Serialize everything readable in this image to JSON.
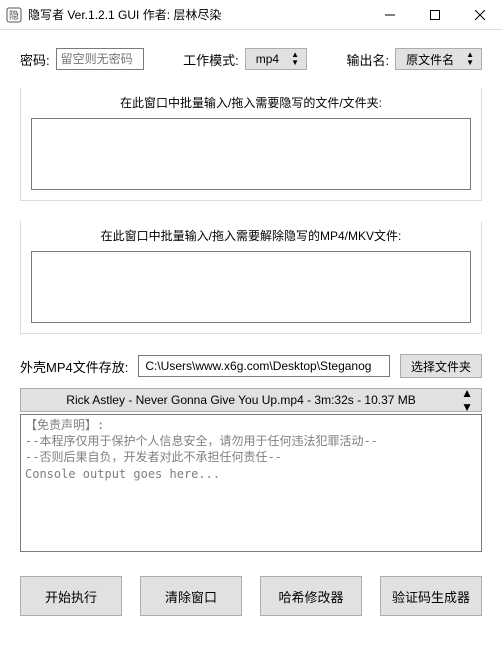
{
  "window": {
    "title": "隐写者 Ver.1.2.1 GUI 作者: 层林尽染"
  },
  "row1": {
    "pw_label": "密码:",
    "pw_placeholder": "留空则无密码",
    "mode_label": "工作模式:",
    "mode_value": "mp4",
    "out_label": "输出名:",
    "out_value": "原文件名"
  },
  "section_hide": {
    "title": "在此窗口中批量输入/拖入需要隐写的文件/文件夹:"
  },
  "section_reveal": {
    "title": "在此窗口中批量输入/拖入需要解除隐写的MP4/MKV文件:"
  },
  "shell": {
    "label": "外壳MP4文件存放:",
    "path": "C:\\Users\\www.x6g.com\\Desktop\\Steganog",
    "browse": "选择文件夹"
  },
  "filebar": {
    "text": "Rick Astley - Never Gonna Give You Up.mp4 - 3m:32s - 10.37 MB"
  },
  "console": {
    "text": "【免责声明】:\n--本程序仅用于保护个人信息安全，请勿用于任何违法犯罪活动--\n--否则后果自负，开发者对此不承担任何责任--\nConsole output goes here..."
  },
  "buttons": {
    "start": "开始执行",
    "clear": "清除窗口",
    "hash": "哈希修改器",
    "captcha": "验证码生成器"
  }
}
